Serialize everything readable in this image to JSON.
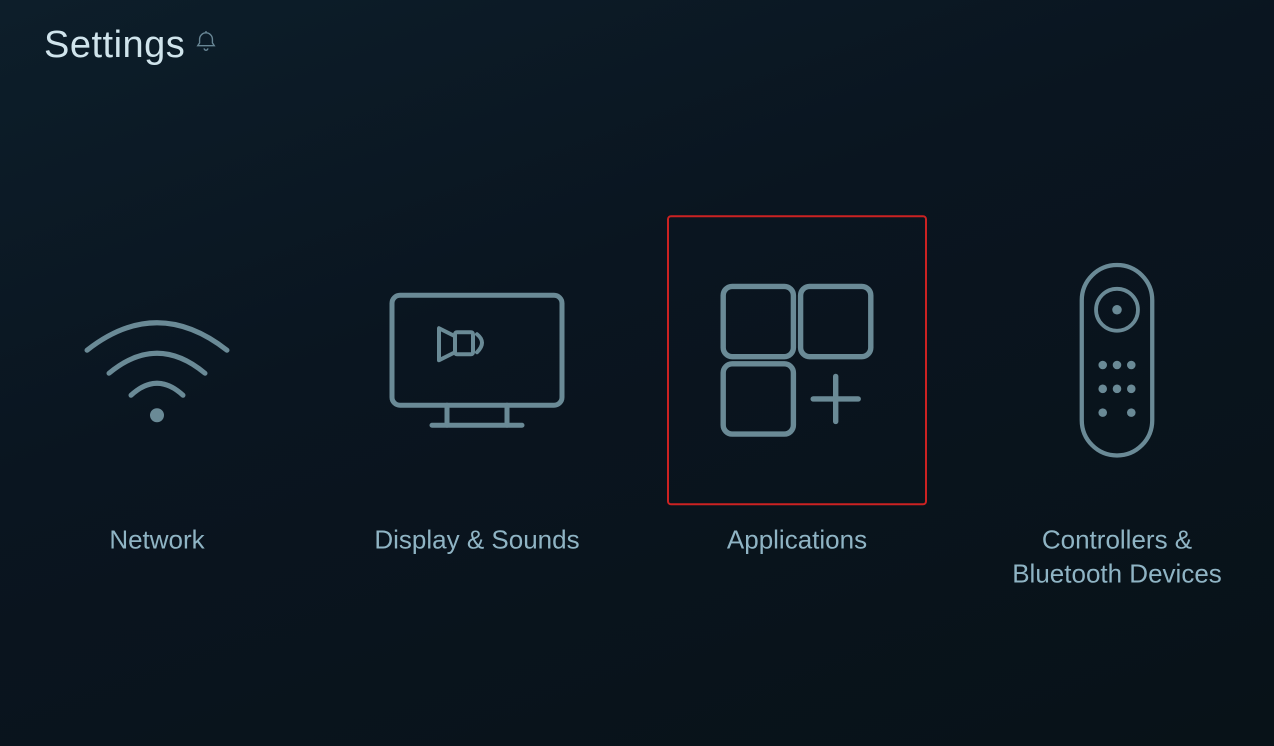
{
  "header": {
    "title": "Settings",
    "bell_icon": "bell-icon"
  },
  "settings": {
    "items": [
      {
        "id": "network",
        "label": "Network",
        "active": false
      },
      {
        "id": "display-sounds",
        "label": "Display & Sounds",
        "active": false
      },
      {
        "id": "applications",
        "label": "Applications",
        "active": true
      },
      {
        "id": "controllers-bluetooth",
        "label": "Controllers &\nBluetooth Devices",
        "active": false
      }
    ]
  },
  "colors": {
    "active_border": "#cc2222",
    "icon_stroke": "#6a8a96",
    "label_color": "#8fb4c4",
    "title_color": "#d0e4ec",
    "bg_start": "#0d1e2a",
    "bg_end": "#081218"
  }
}
